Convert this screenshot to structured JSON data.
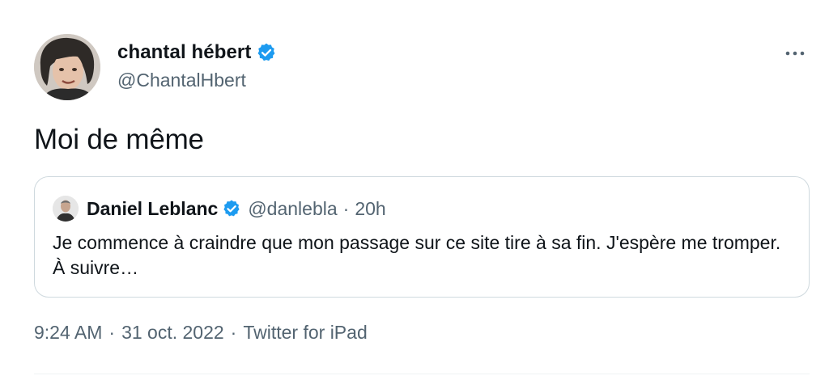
{
  "author": {
    "display_name": "chantal hébert",
    "handle": "@ChantalHbert",
    "verified": true
  },
  "tweet": {
    "text": "Moi de même"
  },
  "quote": {
    "display_name": "Daniel Leblanc",
    "handle": "@danlebla",
    "separator": "·",
    "time": "20h",
    "verified": true,
    "text": "Je commence à craindre que mon passage sur ce site tire à sa fin. J'espère me tromper. À suivre…"
  },
  "meta": {
    "time": "9:24 AM",
    "date": "31 oct. 2022",
    "source": "Twitter for iPad",
    "separator": "·"
  },
  "icons": {
    "verified": "verified-badge-icon",
    "more": "more-options-icon"
  },
  "colors": {
    "verified_blue": "#1d9bf0",
    "secondary_text": "#536471",
    "primary_text": "#0f1419",
    "border": "#cfd9de"
  }
}
